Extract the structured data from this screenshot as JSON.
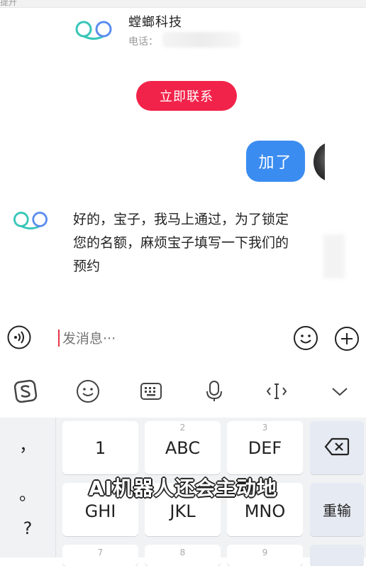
{
  "top": {
    "cropped_text": "提升"
  },
  "company_card": {
    "name": "螳螂科技",
    "phone_label": "电话：",
    "contact_button": "立即联系"
  },
  "chat": {
    "user_message": "加了",
    "bot_message": "好的，宝子，我马上通过，为了锁定您的名额，麻烦宝子填写一下我们的预约"
  },
  "input": {
    "placeholder": "发消息···"
  },
  "keyboard": {
    "punctuation": [
      "，",
      "。",
      "?"
    ],
    "keys": [
      {
        "num": "",
        "letters": "1"
      },
      {
        "num": "2",
        "letters": "ABC"
      },
      {
        "num": "3",
        "letters": "DEF"
      },
      {
        "num": "",
        "letters": "GHI"
      },
      {
        "num": "",
        "letters": "JKL"
      },
      {
        "num": "",
        "letters": "MNO"
      },
      {
        "num": "7",
        "letters": ""
      },
      {
        "num": "8",
        "letters": ""
      },
      {
        "num": "9",
        "letters": ""
      }
    ],
    "reinput": "重输"
  },
  "subtitle": "AI机器人还会主动地",
  "colors": {
    "accent_red": "#f2234a",
    "bubble_blue": "#3b8cf0",
    "logo_teal": "#36c6b8",
    "logo_blue": "#5b8def"
  },
  "icons": {
    "voice": "voice-wave-icon",
    "emoji": "smiley-icon",
    "plus": "plus-circle-icon",
    "toolbar": [
      "sogou-s-icon",
      "smiley-icon",
      "keyboard-icon",
      "microphone-icon",
      "cursor-move-icon",
      "chevron-down-icon"
    ],
    "backspace": "backspace-icon"
  }
}
